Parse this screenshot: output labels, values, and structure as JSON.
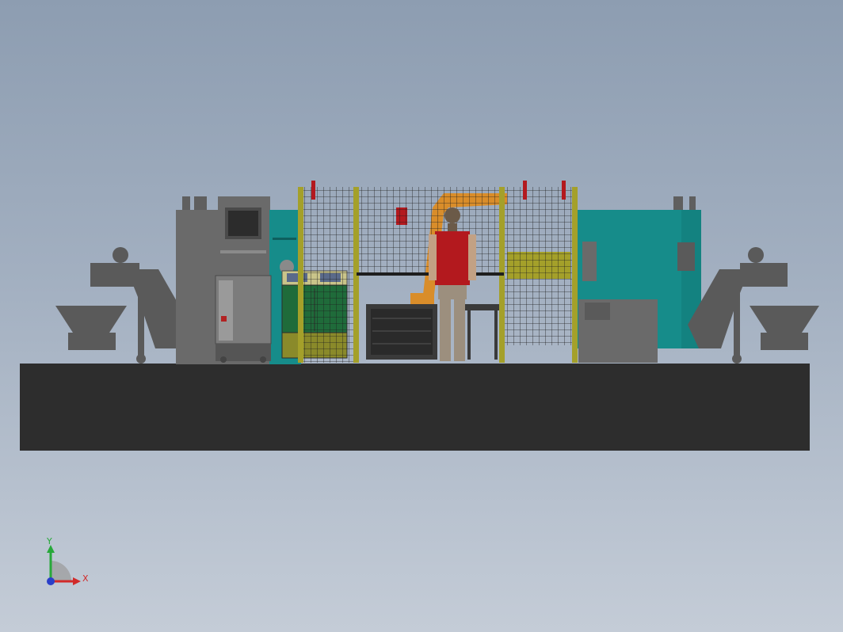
{
  "viewport": {
    "background_top": "#8d9db1",
    "background_bottom": "#c4ccd7"
  },
  "colors": {
    "platform": "#2d2d2d",
    "machine_gray": "#6a6a6a",
    "machine_teal": "#168c8a",
    "fence_frame": "#a4a02a",
    "fence_mesh": "#1e1e1e",
    "robot_orange": "#d98d2a",
    "control_cabinet": "#1f6b3a",
    "person_shirt": "#b3191e",
    "person_pants": "#9c8f7e"
  },
  "scene": {
    "objects": [
      {
        "name": "floor-platform"
      },
      {
        "name": "left-chip-conveyor"
      },
      {
        "name": "left-chip-bin"
      },
      {
        "name": "left-cnc-machine"
      },
      {
        "name": "left-coolant-unit"
      },
      {
        "name": "control-cabinet"
      },
      {
        "name": "safety-fence"
      },
      {
        "name": "robot-arm"
      },
      {
        "name": "parts-table"
      },
      {
        "name": "operator-figure"
      },
      {
        "name": "right-cnc-machine"
      },
      {
        "name": "right-chip-conveyor"
      },
      {
        "name": "right-chip-bin"
      }
    ]
  },
  "triad": {
    "x_label": "X",
    "y_label": "Y",
    "x_color": "#d12a2a",
    "y_color": "#27a83a",
    "z_color": "#2a3fc9"
  }
}
